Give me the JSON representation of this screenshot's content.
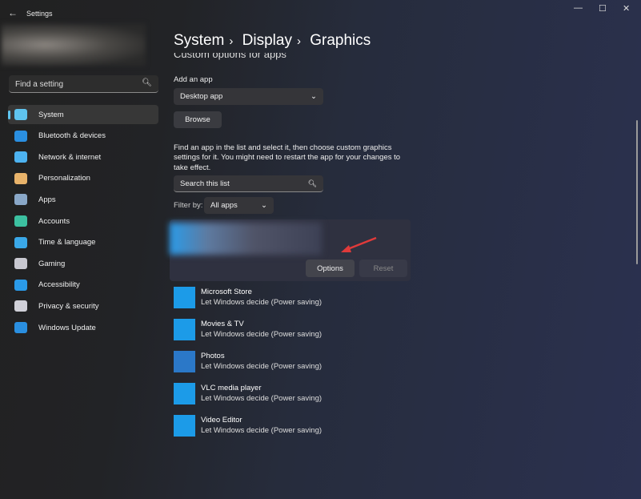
{
  "window": {
    "title": "Settings",
    "back_icon": "arrow-left-icon",
    "controls": {
      "minimize": "—",
      "maximize": "☐",
      "close": "✕"
    }
  },
  "sidebar": {
    "search_placeholder": "Find a setting",
    "items": [
      {
        "label": "System",
        "color": "#5fc4ef",
        "selected": true
      },
      {
        "label": "Bluetooth & devices",
        "color": "#2a8fe0"
      },
      {
        "label": "Network & internet",
        "color": "#4db3f0"
      },
      {
        "label": "Personalization",
        "color": "#e8b36a"
      },
      {
        "label": "Apps",
        "color": "#8aa8c8"
      },
      {
        "label": "Accounts",
        "color": "#3cc0a0"
      },
      {
        "label": "Time & language",
        "color": "#3aa8e8"
      },
      {
        "label": "Gaming",
        "color": "#c8c8d0"
      },
      {
        "label": "Accessibility",
        "color": "#2a9ae8"
      },
      {
        "label": "Privacy & security",
        "color": "#d0d0d8"
      },
      {
        "label": "Windows Update",
        "color": "#2a8fe0"
      }
    ]
  },
  "breadcrumb": [
    "System",
    "Display",
    "Graphics"
  ],
  "main": {
    "section_heading": "Custom options for apps",
    "add_app_label": "Add an app",
    "app_type": "Desktop app",
    "browse": "Browse",
    "description": "Find an app in the list and select it, then choose custom graphics settings for it. You might need to restart the app for your changes to take effect.",
    "search_placeholder": "Search this list",
    "filter_label": "Filter by:",
    "filter_value": "All apps",
    "options": "Options",
    "reset": "Reset",
    "apps": [
      {
        "name": "Microsoft Store",
        "setting": "Let Windows decide (Power saving)",
        "icon": "store-icon",
        "color": "#1c9be8"
      },
      {
        "name": "Movies & TV",
        "setting": "Let Windows decide (Power saving)",
        "icon": "movies-icon",
        "color": "#1c9be8"
      },
      {
        "name": "Photos",
        "setting": "Let Windows decide (Power saving)",
        "icon": "photos-icon",
        "color": "#2b78c8"
      },
      {
        "name": "VLC media player",
        "setting": "Let Windows decide (Power saving)",
        "icon": "vlc-icon",
        "color": "#1c9be8"
      },
      {
        "name": "Video Editor",
        "setting": "Let Windows decide (Power saving)",
        "icon": "video-editor-icon",
        "color": "#1c9be8"
      }
    ]
  }
}
